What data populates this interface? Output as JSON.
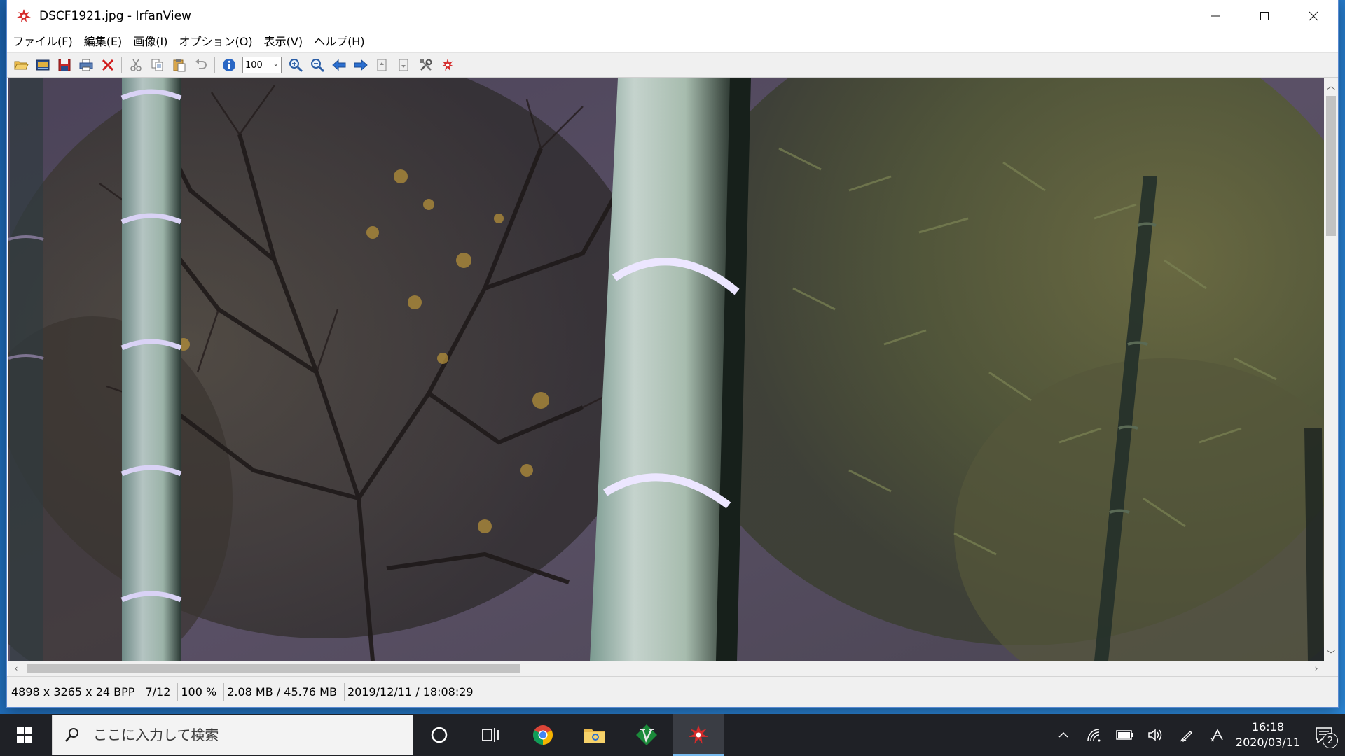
{
  "window": {
    "title": "DSCF1921.jpg - IrfanView",
    "minimize_icon": "minimize-icon",
    "maximize_icon": "maximize-icon",
    "close_icon": "close-icon"
  },
  "menu": {
    "items": [
      {
        "label": "ファイル(F)"
      },
      {
        "label": "編集(E)"
      },
      {
        "label": "画像(I)"
      },
      {
        "label": "オプション(O)"
      },
      {
        "label": "表示(V)"
      },
      {
        "label": "ヘルプ(H)"
      }
    ]
  },
  "toolbar": {
    "zoom_value": "100",
    "icons": [
      "open-folder-icon",
      "thumbnails-icon",
      "save-icon",
      "print-icon",
      "delete-icon",
      "cut-icon",
      "copy-icon",
      "paste-icon",
      "undo-icon",
      "info-icon",
      "zoom-in-icon",
      "zoom-out-icon",
      "previous-icon",
      "next-icon",
      "first-page-icon",
      "last-page-icon",
      "settings-icon",
      "irfanview-logo-icon"
    ]
  },
  "status": {
    "dimensions": "4898 x 3265 x 24 BPP",
    "index": "7/12",
    "zoom": "100 %",
    "size": "2.08 MB / 45.76 MB",
    "datetime": "2019/12/11 / 18:08:29"
  },
  "taskbar": {
    "search_placeholder": "ここに入力して検索",
    "clock_time": "16:18",
    "clock_date": "2020/03/11",
    "notification_count": "2",
    "apps": [
      "cortana-icon",
      "task-view-icon",
      "chrome-icon",
      "file-explorer-icon",
      "vim-icon",
      "irfanview-icon"
    ]
  },
  "colors": {
    "taskbar_bg": "#1f2126",
    "accent": "#76b9ed",
    "irfanview_red": "#d52b2b"
  }
}
